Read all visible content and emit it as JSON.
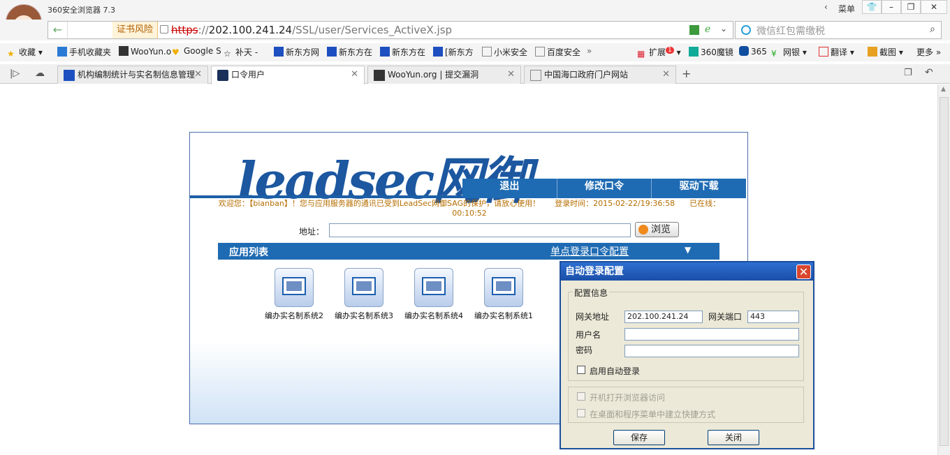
{
  "browser": {
    "title": "360安全浏览器 7.3",
    "menu_label": "菜单",
    "url_scheme": "https",
    "url_sep": "://",
    "url_host": "202.100.241.24",
    "url_path": "/SSL/user/Services_ActiveX.jsp",
    "cert_warning": "证书风险",
    "search_placeholder": "微信红包需缴税"
  },
  "bookmarks": [
    {
      "label": "收藏",
      "icon": "star-plus-icon"
    },
    {
      "label": "手机收藏夹",
      "icon": "phone-icon"
    },
    {
      "label": "WooYun.o",
      "icon": "wooyun-icon"
    },
    {
      "label": "Google S",
      "icon": "google-icon"
    },
    {
      "label": "补天 -",
      "icon": "star-outline-icon"
    },
    {
      "label": "新东方网",
      "icon": "paw-icon"
    },
    {
      "label": "新东方在",
      "icon": "paw-icon"
    },
    {
      "label": "新东方在",
      "icon": "paw-icon"
    },
    {
      "label": "[新东方",
      "icon": "paw-icon"
    },
    {
      "label": "小米安全",
      "icon": "doc-icon"
    },
    {
      "label": "百度安全",
      "icon": "doc-icon"
    }
  ],
  "toolbar_right": [
    {
      "label": "扩展",
      "badge": "1"
    },
    {
      "label": "360魔镜"
    },
    {
      "label": "365"
    },
    {
      "label": "网银"
    },
    {
      "label": "翻译"
    },
    {
      "label": "截图"
    },
    {
      "label": "更多"
    }
  ],
  "tabs": [
    {
      "label": "机构编制统计与实名制信息管理"
    },
    {
      "label": "口令用户"
    },
    {
      "label": "WooYun.org | 提交漏洞"
    },
    {
      "label": "中国海口政府门户网站"
    }
  ],
  "page": {
    "logo": "leadsec网御",
    "menu": [
      "退出",
      "修改口令",
      "驱动下载"
    ],
    "welcome_line1": "欢迎您：【bianban】！您与应用服务器的通讯已受到LeadSec网御SAG的保护，请放心使用！      登录时间：2015-02-22/19:36:58      已在线：",
    "welcome_line2": "00:10:52",
    "addr_label": "地址：",
    "browse_label": "浏览",
    "applist_title": "应用列表",
    "sso_link": "单点登录口令配置",
    "apps": [
      "编办实名制系统2",
      "编办实名制系统3",
      "编办实名制系统4",
      "编办实名制系统1"
    ]
  },
  "dialog": {
    "title": "自动登录配置",
    "group_title": "配置信息",
    "gateway_label": "网关地址",
    "gateway_value": "202.100.241.24",
    "port_label": "网关端口",
    "port_value": "443",
    "user_label": "用户名",
    "user_value": "",
    "pwd_label": "密码",
    "pwd_value": "",
    "auto_login_label": "启用自动登录",
    "open_on_boot_label": "开机打开浏览器访问",
    "shortcut_label": "在桌面和程序菜单中建立快捷方式",
    "save_label": "保存",
    "close_label": "关闭"
  }
}
